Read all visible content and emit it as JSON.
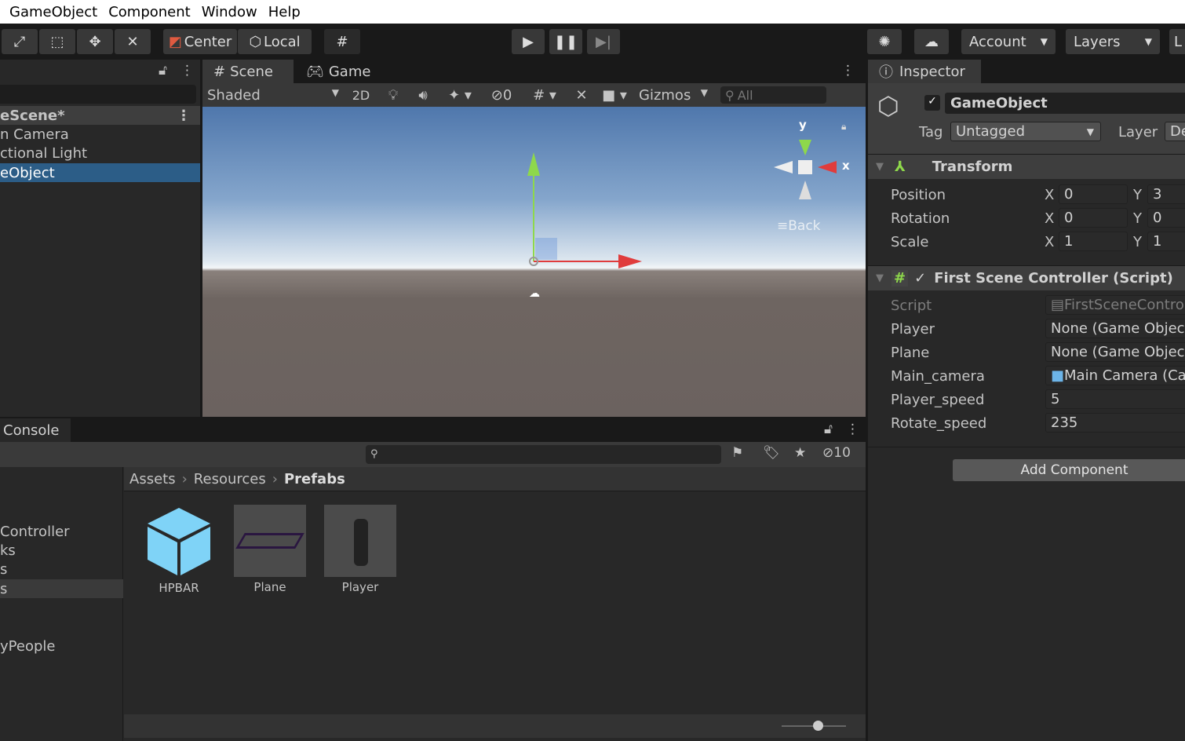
{
  "menu": [
    "GameObject",
    "Component",
    "Window",
    "Help"
  ],
  "toolbar": {
    "pivot": "Center",
    "space": "Local",
    "account": "Account",
    "layers": "Layers",
    "layout": "L"
  },
  "hierarchy": {
    "scene": "eScene*",
    "items": [
      "n Camera",
      "ctional Light",
      "eObject"
    ],
    "selected": 2
  },
  "scene": {
    "tabs": [
      "Scene",
      "Game"
    ],
    "shading": "Shaded",
    "mode_2d": "2D",
    "hidden_count": "0",
    "gizmos": "Gizmos",
    "search_placeholder": "All",
    "axis_y": "y",
    "axis_x": "x",
    "view_label": "Back"
  },
  "inspector": {
    "tab": "Inspector",
    "name": "GameObject",
    "tag_label": "Tag",
    "tag": "Untagged",
    "layer_label": "Layer",
    "layer": "De",
    "transform": {
      "title": "Transform",
      "rows": [
        {
          "label": "Position",
          "x": "0",
          "y": "3"
        },
        {
          "label": "Rotation",
          "x": "0",
          "y": "0"
        },
        {
          "label": "Scale",
          "x": "1",
          "y": "1"
        }
      ]
    },
    "script": {
      "title": "First Scene Controller (Script)",
      "rows": [
        {
          "label": "Script",
          "value": "FirstSceneControl"
        },
        {
          "label": "Player",
          "value": "None (Game Object"
        },
        {
          "label": "Plane",
          "value": "None (Game Object"
        },
        {
          "label": "Main_camera",
          "value": "Main Camera (Ca"
        },
        {
          "label": "Player_speed",
          "value": "5"
        },
        {
          "label": "Rotate_speed",
          "value": "235"
        }
      ]
    },
    "add_component": "Add Component"
  },
  "console": {
    "tab": "Console",
    "hidden_count": "10"
  },
  "project": {
    "breadcrumb": [
      "Assets",
      "Resources",
      "Prefabs"
    ],
    "tree": [
      "Controller",
      "ks",
      "s",
      "s",
      "yPeople"
    ],
    "assets": [
      "HPBAR",
      "Plane",
      "Player"
    ]
  },
  "colors": {
    "selection": "#2c5d87",
    "accent_cube": "#7fd3f7",
    "x_axis": "#e03c3c",
    "y_axis": "#8ed84b"
  }
}
